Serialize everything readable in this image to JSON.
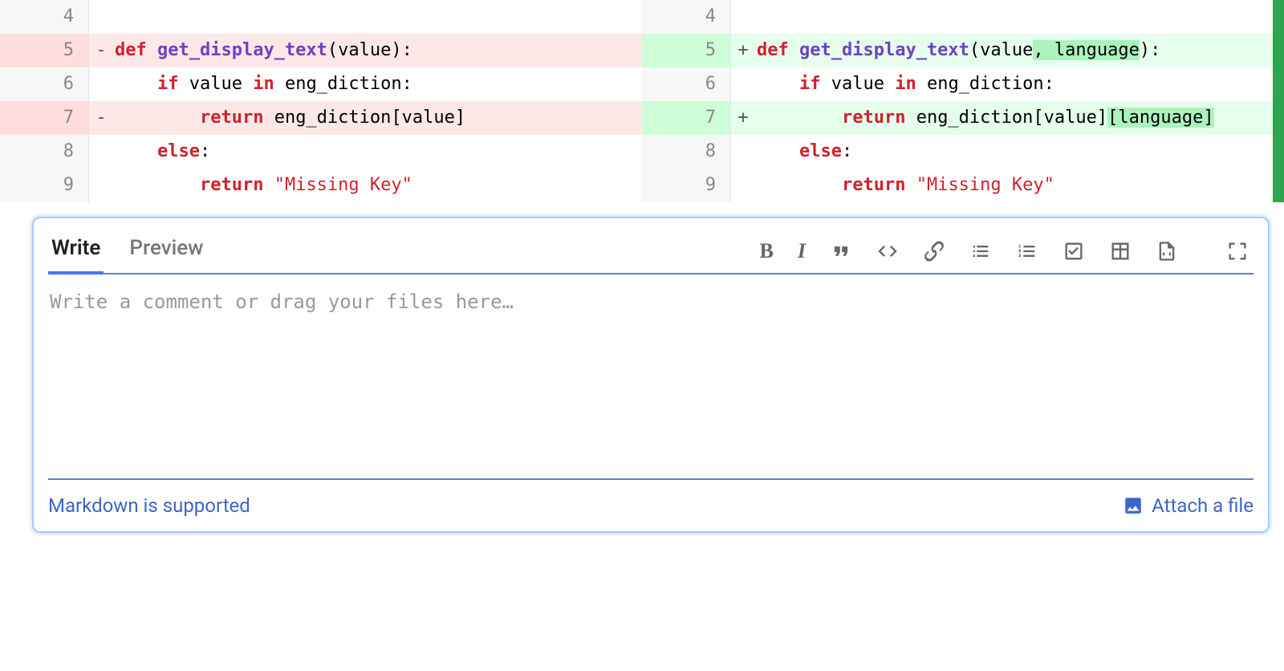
{
  "diff": {
    "left": [
      {
        "n": "4",
        "marker": "",
        "html": "",
        "cls": ""
      },
      {
        "n": "5",
        "marker": "-",
        "html": "<span class='kw'>def</span> <span class='fn'>get_display_text</span>(value):",
        "cls": "row-del"
      },
      {
        "n": "6",
        "marker": "",
        "html": "    <span class='kw'>if</span> value <span class='kw'>in</span> eng_diction:",
        "cls": ""
      },
      {
        "n": "7",
        "marker": "-",
        "html": "        <span class='kw'>return</span> eng_diction[value]",
        "cls": "row-del"
      },
      {
        "n": "8",
        "marker": "",
        "html": "    <span class='kw'>else</span>:",
        "cls": ""
      },
      {
        "n": "9",
        "marker": "",
        "html": "        <span class='kw'>return</span> <span class='str'>\"Missing Key\"</span>",
        "cls": ""
      }
    ],
    "right": [
      {
        "n": "4",
        "marker": "",
        "html": "",
        "cls": ""
      },
      {
        "n": "5",
        "marker": "+",
        "html": "<span class='kw'>def</span> <span class='fn'>get_display_text</span>(value<span class='hl-add'>, language</span>):",
        "cls": "row-add"
      },
      {
        "n": "6",
        "marker": "",
        "html": "    <span class='kw'>if</span> value <span class='kw'>in</span> eng_diction:",
        "cls": ""
      },
      {
        "n": "7",
        "marker": "+",
        "html": "        <span class='kw'>return</span> eng_diction[value]<span class='hl-add'>[language]</span>",
        "cls": "row-add"
      },
      {
        "n": "8",
        "marker": "",
        "html": "    <span class='kw'>else</span>:",
        "cls": ""
      },
      {
        "n": "9",
        "marker": "",
        "html": "        <span class='kw'>return</span> <span class='str'>\"Missing Key\"</span>",
        "cls": ""
      }
    ]
  },
  "tabs": {
    "write": "Write",
    "preview": "Preview"
  },
  "textarea": {
    "placeholder": "Write a comment or drag your files here…"
  },
  "footer": {
    "markdown": "Markdown is supported",
    "attach": "Attach a file"
  }
}
